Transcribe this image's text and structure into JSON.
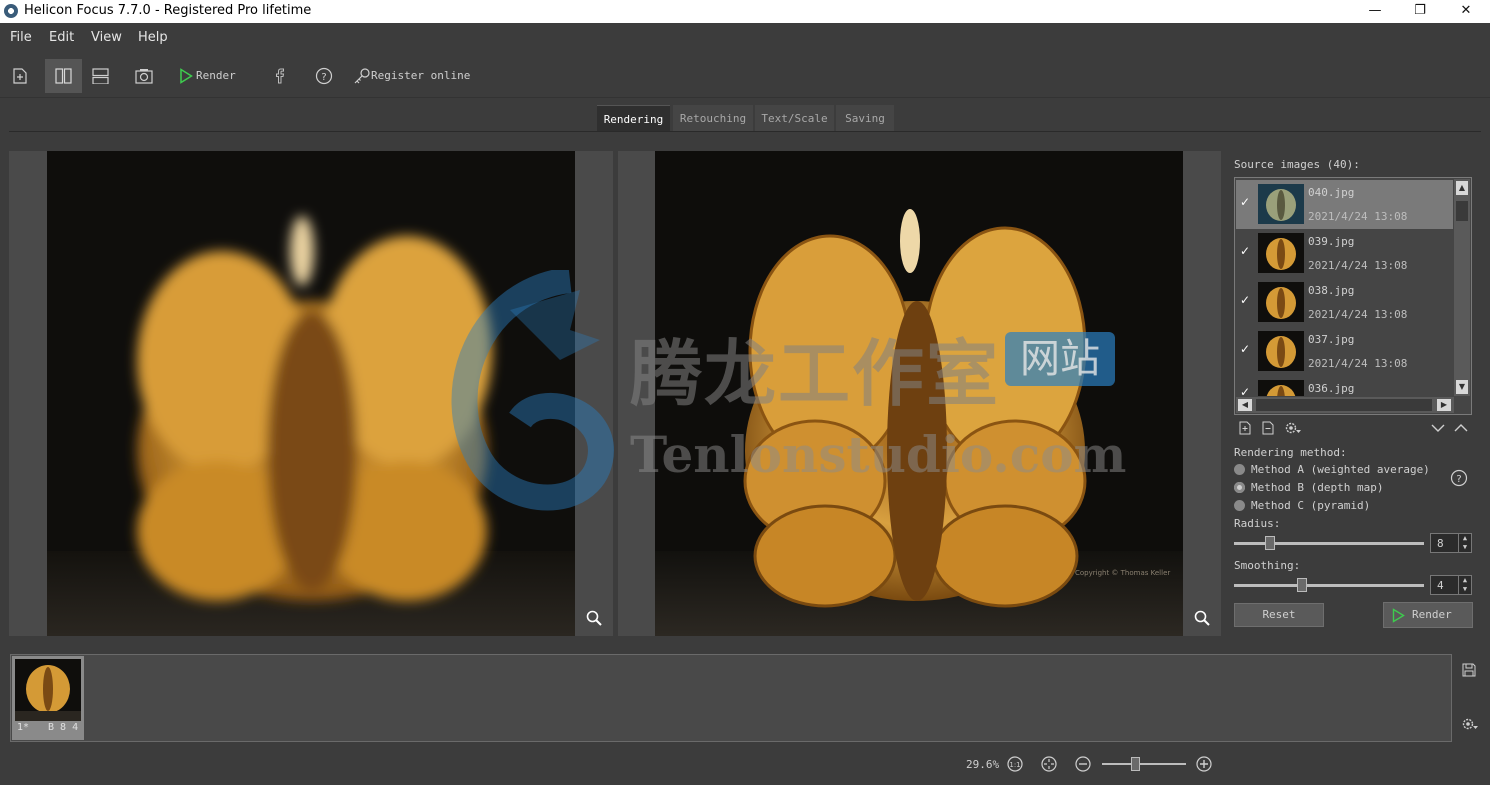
{
  "window": {
    "title": "Helicon Focus 7.7.0 - Registered Pro lifetime",
    "controls": {
      "minimize": "—",
      "maximize": "❐",
      "close": "✕"
    }
  },
  "menu": [
    "File",
    "Edit",
    "View",
    "Help"
  ],
  "toolbar": {
    "render_label": "Render",
    "register_label": "Register online",
    "icons": [
      "new-stack-icon",
      "two-panes-icon",
      "stacked-panes-icon",
      "camera-icon",
      "play-icon",
      "facebook-icon",
      "help-icon",
      "key-icon"
    ]
  },
  "tabs": [
    "Rendering",
    "Retouching",
    "Text/Scale",
    "Saving"
  ],
  "active_tab": "Rendering",
  "preview": {
    "copyright": "Copyright © Thomas Keller"
  },
  "source_images": {
    "header": "Source images (40):",
    "items": [
      {
        "name": "040.jpg",
        "date": "2021/4/24 13:08",
        "checked": true,
        "selected": true
      },
      {
        "name": "039.jpg",
        "date": "2021/4/24 13:08",
        "checked": true,
        "selected": false
      },
      {
        "name": "038.jpg",
        "date": "2021/4/24 13:08",
        "checked": true,
        "selected": false
      },
      {
        "name": "037.jpg",
        "date": "2021/4/24 13:08",
        "checked": true,
        "selected": false
      },
      {
        "name": "036.jpg",
        "date": "",
        "checked": true,
        "selected": false
      }
    ]
  },
  "rendering": {
    "method_header": "Rendering method:",
    "methods": [
      {
        "label": "Method A (weighted average)",
        "selected": false
      },
      {
        "label": "Method B (depth map)",
        "selected": true
      },
      {
        "label": "Method C (pyramid)",
        "selected": false
      }
    ],
    "radius_label": "Radius:",
    "radius_value": "8",
    "radius_fraction": 0.17,
    "smoothing_label": "Smoothing:",
    "smoothing_value": "4",
    "smoothing_fraction": 0.35,
    "reset_label": "Reset",
    "render_label": "Render"
  },
  "output_strip": {
    "item_index": "1*",
    "item_info": "B 8 4"
  },
  "status": {
    "zoom": "29.6%",
    "zoom_slider_fraction": 0.38
  },
  "watermark": {
    "cn_text": "腾龙工作室",
    "badge_text": "网站",
    "latin_text": "Tenlonstudio.com"
  },
  "colors": {
    "background": "#3c3c3c",
    "accent_green": "#3ecb4e",
    "watermark_blue": "#2a7fc0"
  }
}
